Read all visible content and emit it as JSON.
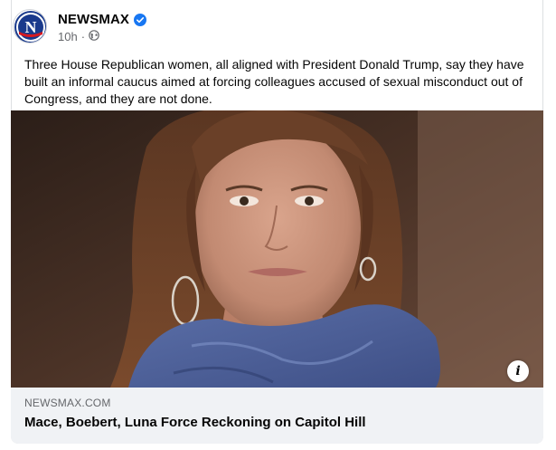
{
  "post": {
    "page_name": "NEWSMAX",
    "timestamp": "10h",
    "separator": "·",
    "audience_icon": "globe-icon",
    "verified_icon": "verified-badge-icon",
    "text": "Three House Republican women, all aligned with President Donald Trump, say they have built an informal caucus aimed at forcing colleagues accused of sexual misconduct out of Congress, and they are not done."
  },
  "link_preview": {
    "domain": "NEWSMAX.COM",
    "title": "Mace, Boebert, Luna Force Reckoning on Capitol Hill",
    "info_icon": "info-icon",
    "info_label": "i"
  },
  "avatar": {
    "letter": "N",
    "brand_color": "#1a3a8c",
    "accent_color": "#d71920"
  },
  "colors": {
    "verified": "#1877f2",
    "footer_bg": "#f0f2f5",
    "text_primary": "#050505",
    "text_secondary": "#65676b"
  }
}
